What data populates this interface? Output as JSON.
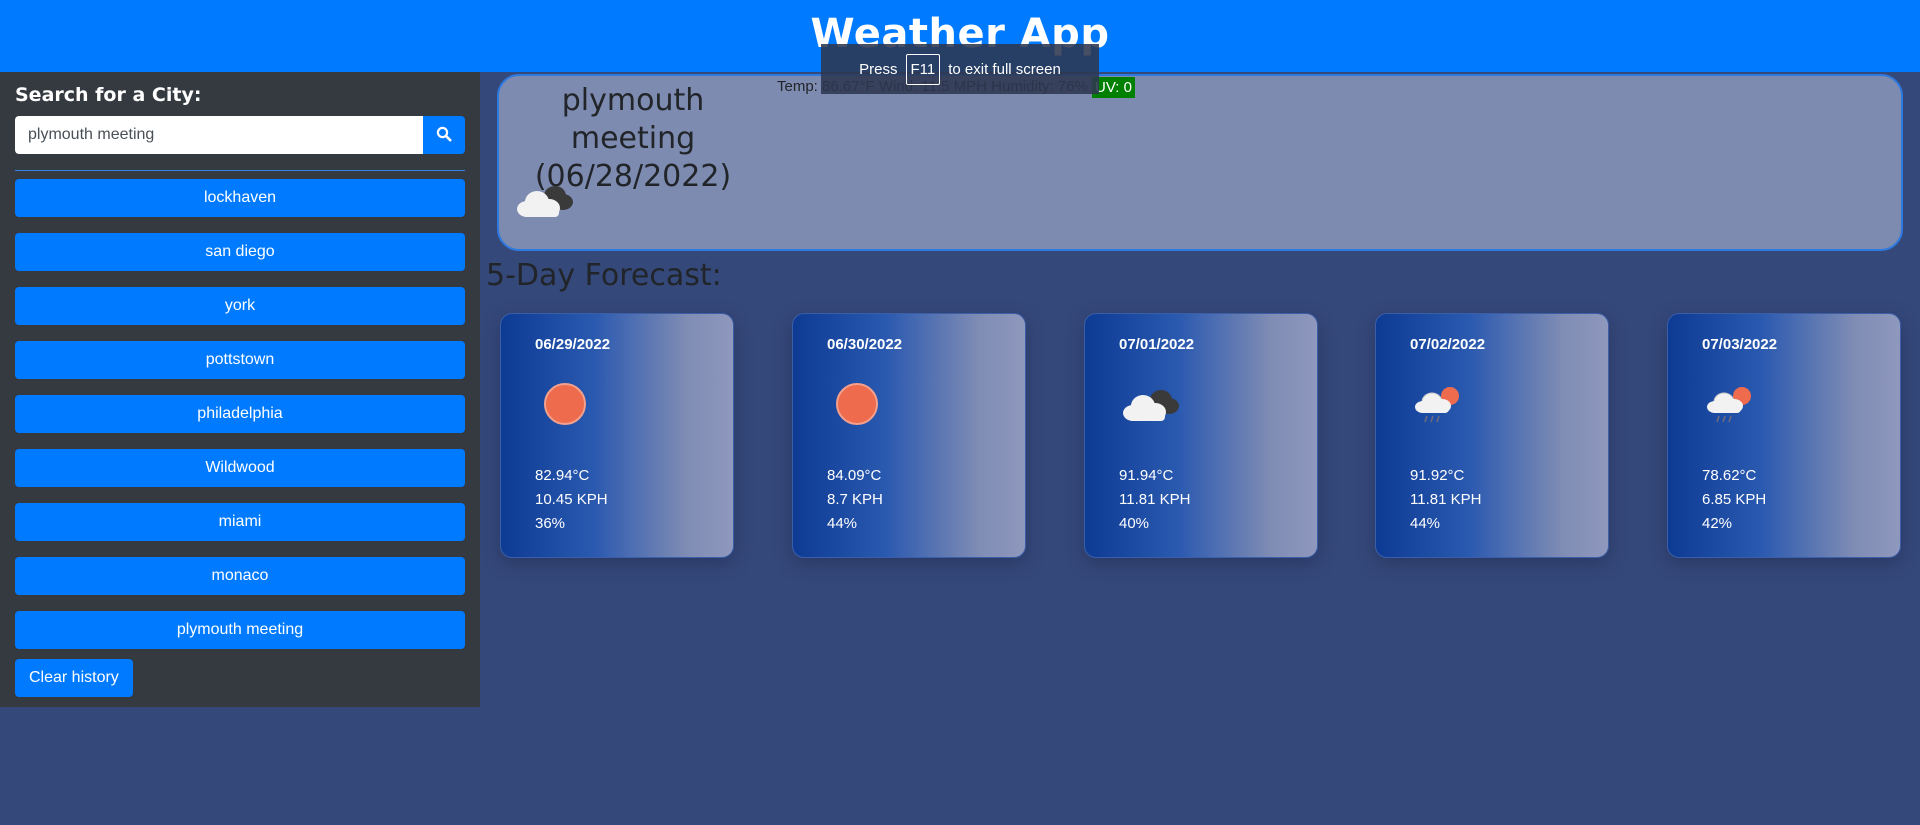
{
  "header": {
    "title": "Weather App"
  },
  "sidebar": {
    "search_title": "Search for a City:",
    "search_value": "plymouth meeting",
    "search_icon": "search-icon",
    "history": [
      "lockhaven",
      "san diego",
      "york",
      "pottstown",
      "philadelphia",
      "Wildwood",
      "miami",
      "monaco",
      "plymouth meeting"
    ],
    "clear_label": "Clear history"
  },
  "current": {
    "city": "plymouth meeting",
    "date": "(06/28/2022)",
    "icon": "dark-cloud-icon",
    "stats": "Temp: 86.67°F Wind: 11.5 MPH Humidity: 76%",
    "uv": "UV: 0",
    "uv_color": "#008000"
  },
  "toast": {
    "press": "Press",
    "key": "F11",
    "rest": "to exit full screen"
  },
  "forecast": {
    "title": "5-Day Forecast:",
    "days": [
      {
        "date": "06/29/2022",
        "icon": "sun-icon",
        "temp": "82.94°C",
        "wind": "10.45 KPH",
        "humidity": "36%"
      },
      {
        "date": "06/30/2022",
        "icon": "sun-icon",
        "temp": "84.09°C",
        "wind": "8.7 KPH",
        "humidity": "44%"
      },
      {
        "date": "07/01/2022",
        "icon": "dark-cloud-icon",
        "temp": "91.94°C",
        "wind": "11.81 KPH",
        "humidity": "40%"
      },
      {
        "date": "07/02/2022",
        "icon": "rain-sun-icon",
        "temp": "91.92°C",
        "wind": "11.81 KPH",
        "humidity": "44%"
      },
      {
        "date": "07/03/2022",
        "icon": "rain-sun-icon",
        "temp": "78.62°C",
        "wind": "6.85 KPH",
        "humidity": "42%"
      }
    ]
  },
  "colors": {
    "accent": "#007bff",
    "sidebar": "#343a40",
    "background": "#35487a",
    "current_card": "#7e8bb0"
  }
}
